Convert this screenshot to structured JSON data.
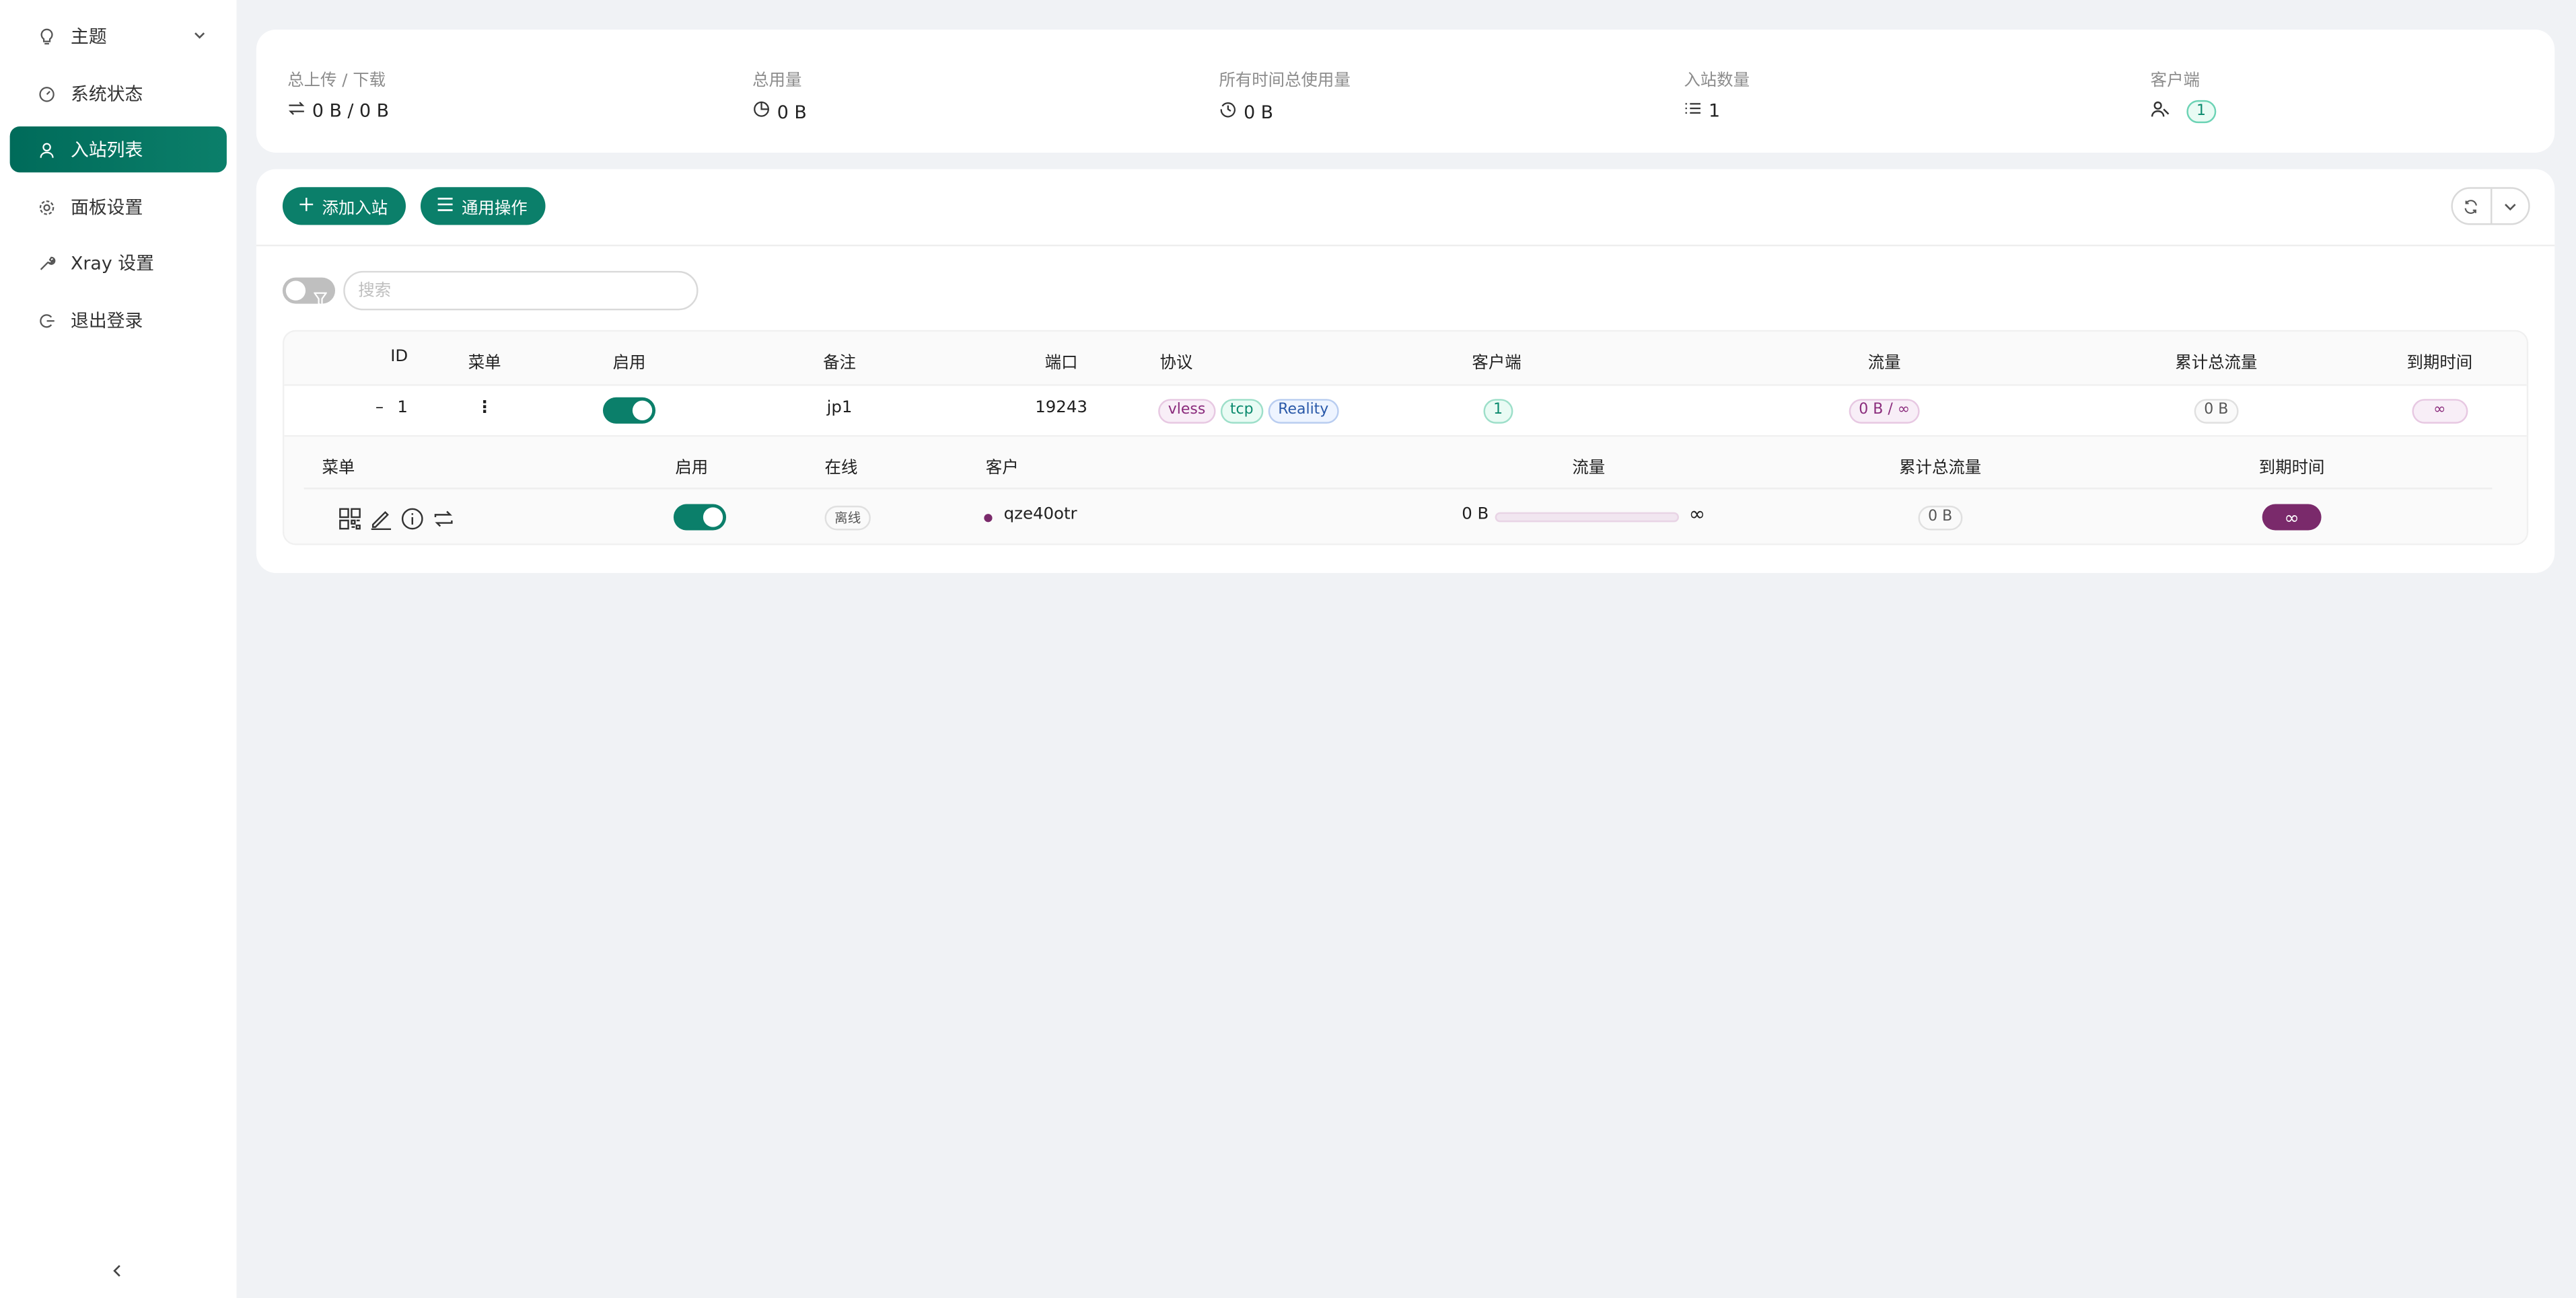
{
  "sidebar": {
    "items": [
      {
        "label": "主题",
        "icon": "bulb-icon"
      },
      {
        "label": "系统状态",
        "icon": "dashboard-icon"
      },
      {
        "label": "入站列表",
        "icon": "user-icon"
      },
      {
        "label": "面板设置",
        "icon": "gear-icon"
      },
      {
        "label": "Xray 设置",
        "icon": "tool-icon"
      },
      {
        "label": "退出登录",
        "icon": "logout-icon"
      }
    ],
    "active_index": 2
  },
  "stats": {
    "upload_download_label": "总上传 / 下载",
    "upload_download_value": "0 B / 0 B",
    "total_usage_label": "总用量",
    "total_usage_value": "0 B",
    "alltime_usage_label": "所有时间总使用量",
    "alltime_usage_value": "0 B",
    "inbound_count_label": "入站数量",
    "inbound_count_value": "1",
    "clients_label": "客户端",
    "clients_value": "1"
  },
  "toolbar": {
    "add_inbound_label": "添加入站",
    "general_actions_label": "通用操作"
  },
  "search": {
    "placeholder": "搜索"
  },
  "table": {
    "headers": {
      "id": "ID",
      "menu": "菜单",
      "enable": "启用",
      "remark": "备注",
      "port": "端口",
      "protocol": "协议",
      "clients": "客户端",
      "traffic": "流量",
      "total_traffic": "累计总流量",
      "expiry": "到期时间"
    },
    "rows": [
      {
        "expand_symbol": "–",
        "id": "1",
        "menu_symbol": "⋮",
        "enabled": true,
        "remark": "jp1",
        "port": "19243",
        "protocol_tags": [
          "vless",
          "tcp",
          "Reality"
        ],
        "clients": "1",
        "traffic": "0 B / ∞",
        "total_traffic": "0 B",
        "expiry": "∞"
      }
    ],
    "client_headers": {
      "menu": "菜单",
      "enable": "启用",
      "online": "在线",
      "client": "客户",
      "traffic": "流量",
      "total_traffic": "累计总流量",
      "expiry": "到期时间"
    },
    "client_rows": [
      {
        "enabled": true,
        "online_status": "离线",
        "email": "qze40otr",
        "traffic_used": "0 B",
        "traffic_limit": "∞",
        "total_traffic": "0 B",
        "expiry": "∞"
      }
    ]
  },
  "colors": {
    "accent": "#0b7f6a",
    "sidebar_active": "#006b5a",
    "expiry_pill": "#7a2a6b",
    "background": "#f0f2f5"
  }
}
